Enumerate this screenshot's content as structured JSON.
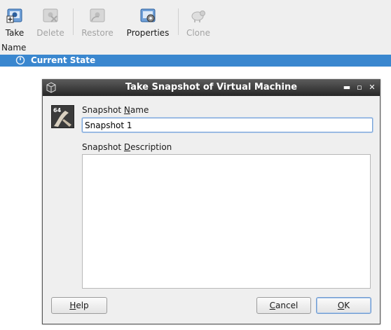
{
  "toolbar": {
    "take_label": "Take",
    "delete_label": "Delete",
    "restore_label": "Restore",
    "properties_label": "Properties",
    "clone_label": "Clone"
  },
  "tree": {
    "column_header": "Name",
    "rows": [
      {
        "label": "Current State",
        "selected": true
      }
    ]
  },
  "dialog": {
    "title": "Take Snapshot of Virtual Machine",
    "window_buttons": {
      "minimize": "▬",
      "maximize": "▫",
      "close": "✕"
    },
    "vm_icon_badge": "64",
    "name_label_pre": "Snapshot ",
    "name_label_mnemonic": "N",
    "name_label_post": "ame",
    "name_value": "Snapshot 1",
    "description_label_pre": "Snapshot ",
    "description_label_mnemonic": "D",
    "description_label_post": "escription",
    "description_value": "",
    "help_label_mnemonic": "H",
    "help_label_post": "elp",
    "cancel_label_mnemonic": "C",
    "cancel_label_post": "ancel",
    "ok_label_mnemonic": "O",
    "ok_label_post": "K"
  },
  "colors": {
    "selection": "#3a87cf",
    "titlebar": "#262626",
    "focus_border": "#7aa3d6"
  }
}
